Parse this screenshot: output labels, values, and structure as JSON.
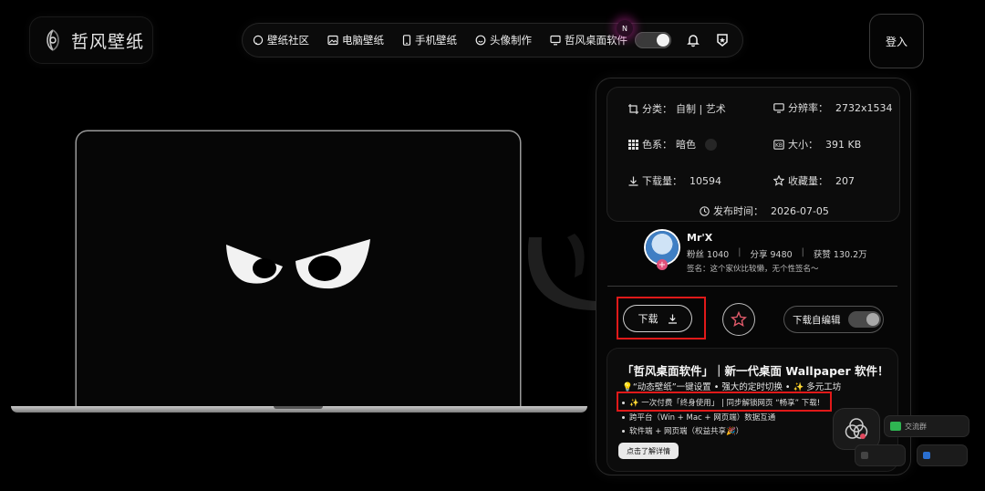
{
  "site": {
    "logo_text": "哲风壁纸"
  },
  "nav": {
    "items": [
      {
        "label": "壁纸社区",
        "icon": "chat-bubble-icon"
      },
      {
        "label": "电脑壁纸",
        "icon": "image-icon"
      },
      {
        "label": "手机壁纸",
        "icon": "phone-icon"
      },
      {
        "label": "头像制作",
        "icon": "face-icon"
      },
      {
        "label": "哲风桌面软件",
        "icon": "monitor-icon"
      }
    ],
    "new_badge": "N",
    "theme_toggle_on": true
  },
  "login": {
    "label": "登入"
  },
  "details": {
    "category_label": "分类：",
    "category_value": "自制 | 艺术",
    "resolution_label": "分辨率：",
    "resolution_value": "2732x1534",
    "color_label": "色系：",
    "color_value": "暗色",
    "size_label": "大小：",
    "size_value": "391 KB",
    "downloads_label": "下载量：",
    "downloads_value": "10594",
    "favorites_label": "收藏量：",
    "favorites_value": "207",
    "published_label": "发布时间：",
    "published_value": "2026-07-05"
  },
  "author": {
    "name": "Mr'X",
    "fans_label": "粉丝",
    "fans_value": "1040",
    "shares_label": "分享",
    "shares_value": "9480",
    "likes_label": "获赞",
    "likes_value": "130.2万",
    "signature": "签名：这个家伙比较懒，无个性签名～",
    "add_badge": "+"
  },
  "actions": {
    "download_label": "下载",
    "download_edit_label": "下载自编辑"
  },
  "promo": {
    "title": "「哲风桌面软件」｜新一代桌面 Wallpaper 软件！",
    "line1": "💡“动态壁纸”一键设置 • 强大的定时切换 • ✨ 多元工坊",
    "bullets": [
      "✨ 一次付费「终身使用」 | 同步解锁网页 “畅享” 下载!",
      "跨平台（Win + Mac + 网页端）数据互通",
      "软件端 + 网页端（权益共享🎉）"
    ],
    "more_label": "点击了解详情"
  },
  "floating": {
    "chip_label": "交流群"
  },
  "colors": {
    "highlight": "#e01919",
    "background": "#000000"
  }
}
